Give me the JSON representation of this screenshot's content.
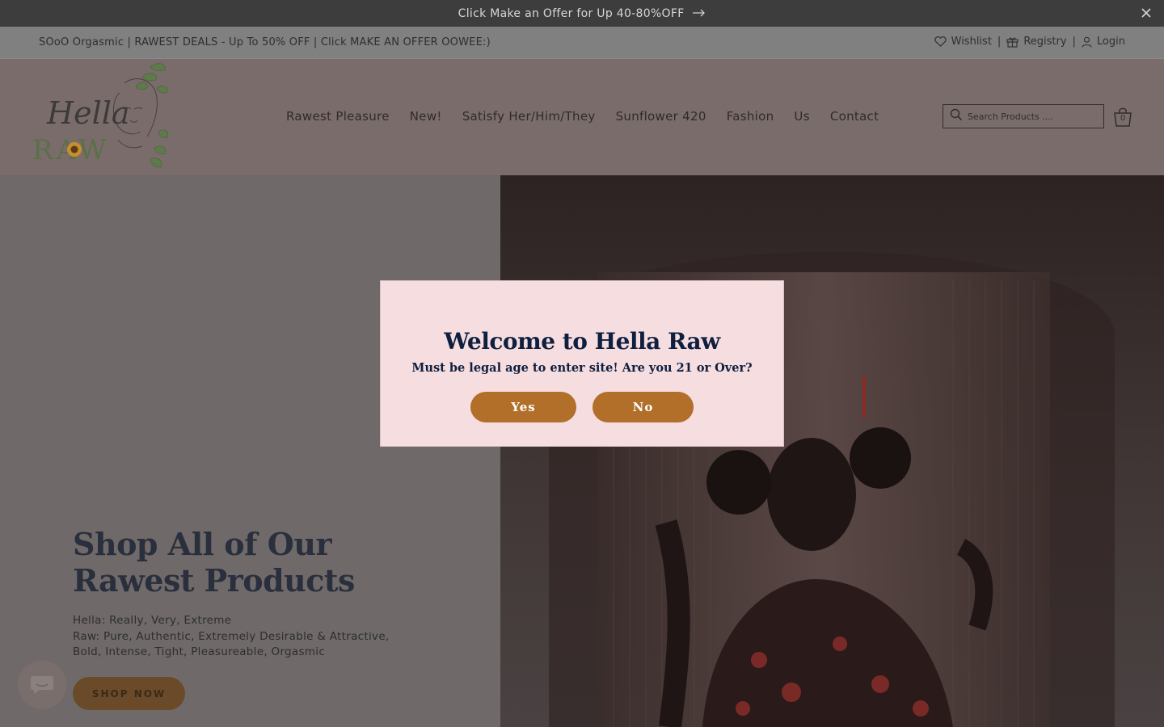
{
  "announcement": {
    "text": "Click Make an Offer for Up 40-80%OFF"
  },
  "utility_bar": {
    "promo": "SOoO Orgasmic | RAWEST DEALS - Up To 50% OFF | Click MAKE AN OFFER OOWEE:)",
    "wishlist": "Wishlist",
    "registry": "Registry",
    "login": "Login",
    "separator": "|"
  },
  "header": {
    "nav": [
      "Rawest Pleasure",
      "New!",
      "Satisfy Her/Him/They",
      "Sunflower 420",
      "Fashion",
      "Us",
      "Contact"
    ],
    "search_placeholder": "Search Products ....",
    "cart_count": "0"
  },
  "logo": {
    "word1": "Hella",
    "word2": "RAW"
  },
  "hero": {
    "title_line1": "Shop All of Our",
    "title_line2": "Rawest Products",
    "desc_line1": "Hella: Really, Very, Extreme",
    "desc_line2": "Raw: Pure, Authentic, Extremely Desirable & Attractive,",
    "desc_line3": "Bold, Intense, Tight, Pleasureable, Orgasmic",
    "button": "SHOP NOW"
  },
  "modal": {
    "title": "Welcome to Hella Raw",
    "subtitle": "Must be legal age to enter site! Are you 21 or Over?",
    "yes": "Yes",
    "no": "No"
  },
  "colors": {
    "modal_bg": "#f5dde0",
    "modal_button": "#b16f2a",
    "modal_text": "#0f1f3f",
    "overlay_header": "#7a6c6a"
  }
}
